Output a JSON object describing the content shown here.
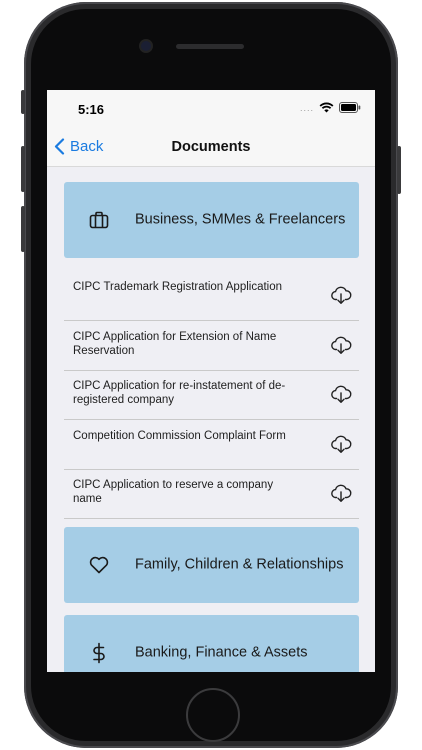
{
  "status_bar": {
    "time": "5:16",
    "dots": "....",
    "icons": [
      "wifi-icon",
      "battery-icon"
    ]
  },
  "nav": {
    "back_label": "Back",
    "title": "Documents"
  },
  "categories": [
    {
      "title": "Business, SMMes & Freelancers",
      "icon": "briefcase-icon"
    },
    {
      "title": "Family, Children & Relationships",
      "icon": "heart-icon"
    },
    {
      "title": "Banking, Finance & Assets",
      "icon": "dollar-icon"
    }
  ],
  "documents": [
    {
      "title": "CIPC Trademark Registration Application",
      "icon": "cloud-download-icon"
    },
    {
      "title": "CIPC Application for Extension of Name Reservation",
      "icon": "cloud-download-icon"
    },
    {
      "title": "CIPC Application for re-instatement of de-registered company",
      "icon": "cloud-download-icon"
    },
    {
      "title": "Competition Commission Complaint Form",
      "icon": "cloud-download-icon"
    },
    {
      "title": "CIPC Application to reserve a company name",
      "icon": "cloud-download-icon"
    }
  ],
  "colors": {
    "accent": "#1a7be0",
    "card_bg": "#a5cde6",
    "screen_bg": "#efeff4"
  }
}
